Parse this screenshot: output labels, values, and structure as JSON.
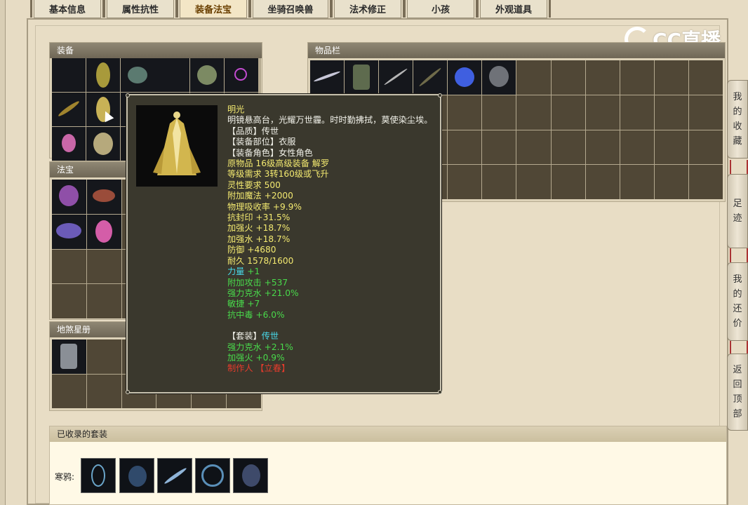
{
  "tabs": [
    "基本信息",
    "属性抗性",
    "装备法宝",
    "坐骑召唤兽",
    "法术修正",
    "小孩",
    "外观道具"
  ],
  "active_tab": "装备法宝",
  "logo_text": "CC直播",
  "panels": {
    "equipment": "装备",
    "treasure": "法宝",
    "stars": "地煞星册",
    "inventory": "物品栏",
    "suits": "已收录的套装"
  },
  "suits": {
    "label": "寒鸦:",
    "count": 5
  },
  "side_buttons": [
    [
      "我",
      "的",
      "收",
      "藏"
    ],
    [
      "足",
      "迹"
    ],
    [
      "我",
      "的",
      "还",
      "价"
    ],
    [
      "返",
      "回",
      "顶",
      "部"
    ]
  ],
  "tooltip": {
    "name": "明光",
    "description": "明镜悬高台，光耀万世霾。时时勤拂拭，莫使染尘埃。",
    "quality": "【品质】传世",
    "slot": "【装备部位】衣服",
    "role": "【装备角色】女性角色",
    "origin": "原物品 16级高级装备 解罗",
    "level_req": "等级需求 3转160级或飞升",
    "spirit_req": "灵性要求 500",
    "stats_white": [
      "附加魔法 +2000",
      "物理吸收率 +9.9%",
      "抗封印 +31.5%",
      "加强火 +18.7%",
      "加强水 +18.7%",
      "防御 +4680",
      "耐久 1578/1600"
    ],
    "stat_cyan_label": "力量",
    "stat_cyan_value": "+1",
    "stats_green": [
      "附加攻击 +537",
      "强力克水 +21.0%",
      "敏捷 +7",
      "抗中毒 +6.0%"
    ],
    "set_label": "【套装】",
    "set_name": "传世",
    "set_stats": [
      "强力克水 +2.1%",
      "加强火 +0.9%"
    ],
    "maker": "制作人 【立春】"
  },
  "colors": {
    "tooltip_yellow": "#f3e970",
    "tooltip_cyan": "#48d7e8",
    "tooltip_green": "#49d94b",
    "tooltip_red": "#e63b2c"
  }
}
